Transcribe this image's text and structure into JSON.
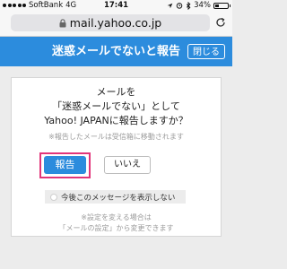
{
  "status_bar": {
    "carrier": "SoftBank",
    "network": "4G",
    "time": "17:41",
    "battery_percent": "34%",
    "battery_level": 0.34
  },
  "url_bar": {
    "url": "mail.yahoo.co.jp"
  },
  "header": {
    "title": "迷惑メールでないと報告",
    "close_label": "閉じる",
    "color": "#2c8cdd"
  },
  "dialog": {
    "line1": "メールを",
    "line2": "「迷惑メールでない」として",
    "line3": "Yahoo! JAPANに報告しますか？",
    "note": "※報告したメールは受信箱に移動されます",
    "report_label": "報告",
    "no_label": "いいえ",
    "hide_label": "今後このメッセージを表示しない",
    "foot1": "※設定を変える場合は",
    "foot2": "「メールの設定」から変更できます",
    "highlight_color": "#e2357a"
  }
}
